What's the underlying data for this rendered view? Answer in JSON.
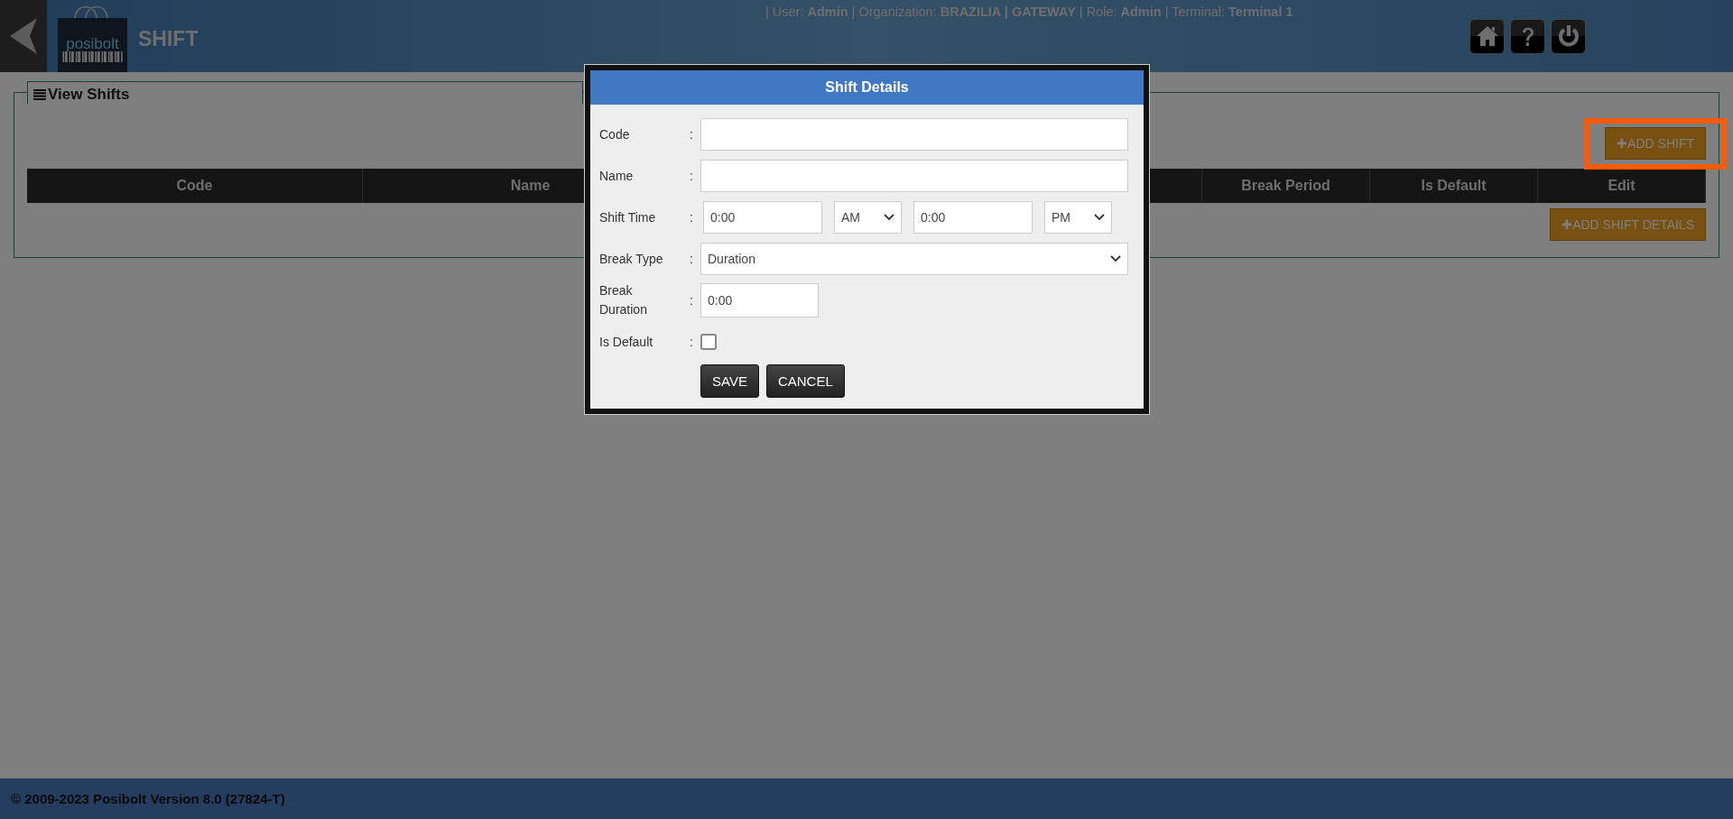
{
  "header": {
    "logo_text": "posibolt",
    "page_title": "SHIFT",
    "user_info": "| User: **Admin** | Organization: **BRAZILIA | GATEWAY** | Role: **Admin** | Terminal: **Terminal 1**"
  },
  "panel": {
    "title": "View Shifts",
    "add_button": "ADD SHIFT",
    "add_details_button": "ADD SHIFT DETAILS",
    "add_icon": "✚",
    "columns": [
      "Code",
      "Name",
      "Break Period",
      "Is Default",
      "Edit"
    ]
  },
  "highlight": {
    "on": true
  },
  "dialog": {
    "title": "Shift Details",
    "fields": [
      {
        "kind": "text",
        "label": "Code"
      },
      {
        "kind": "text",
        "label": "Name"
      },
      {
        "kind": "time",
        "label": "Shift Time",
        "start": "0:00",
        "start_period": "AM",
        "end": "0:00",
        "end_period": "PM"
      },
      {
        "kind": "select",
        "label": "Break Type",
        "value": "Duration"
      },
      {
        "kind": "short",
        "label": "Break Duration",
        "value": "0:00"
      },
      {
        "kind": "checkbox",
        "label": "Is Default",
        "checked": false
      }
    ],
    "separator": ":",
    "buttons": [
      "SAVE",
      "CANCEL"
    ]
  },
  "footer": "© 2009-2023 Posibolt Version 8.0 (27824-T)"
}
